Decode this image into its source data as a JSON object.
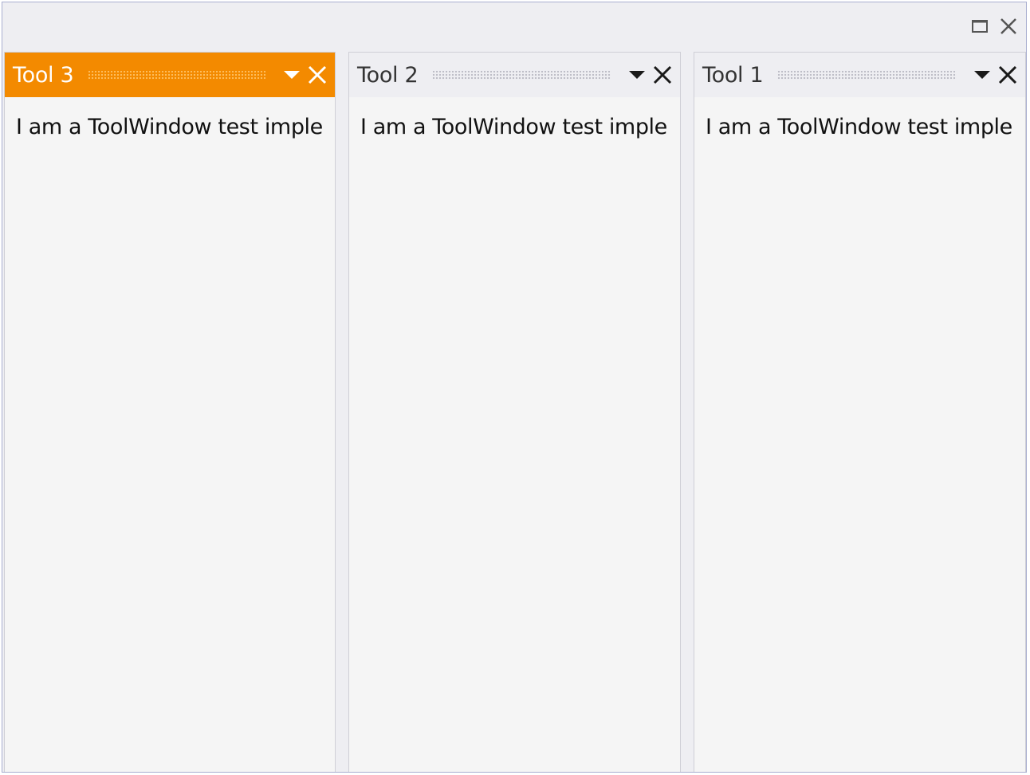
{
  "window": {
    "controls": {
      "maximize_icon": "maximize-icon",
      "close_icon": "close-icon"
    }
  },
  "panes": [
    {
      "title": "Tool 3",
      "active": true,
      "content": "I am a ToolWindow test imple"
    },
    {
      "title": "Tool 2",
      "active": false,
      "content": "I am a ToolWindow test imple"
    },
    {
      "title": "Tool 1",
      "active": false,
      "content": "I am a ToolWindow test imple"
    }
  ],
  "colors": {
    "accent": "#f38a00",
    "background": "#eeeef2",
    "pane_background": "#f5f5f5",
    "border": "#a9aed0"
  }
}
